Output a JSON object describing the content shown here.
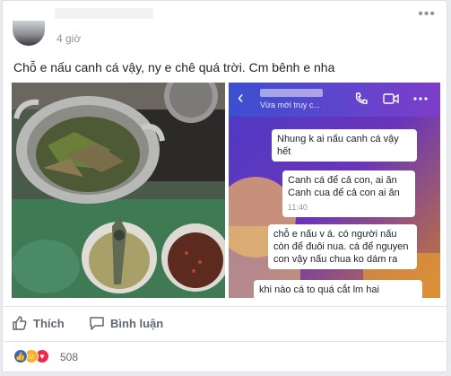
{
  "post": {
    "time": "4 giờ",
    "text": "Chỗ e nấu canh cá vậy, ny e chê quá trời. Cm bênh e nha",
    "more_label": "•••"
  },
  "chat": {
    "status": "Vừa mới truy c...",
    "messages": [
      {
        "lines": [
          "Nhung k ai nấu canh cá vậy",
          "hết"
        ]
      },
      {
        "lines": [
          "Canh cá để cả con, ai ăn",
          "Canh cua để cả con ai ăn"
        ],
        "time": "11:40"
      },
      {
        "lines": [
          "chỗ e nấu v á. có người nấu",
          "còn để đuôi nua. cá để nguyen",
          "con vậy nấu chua ko dám ra"
        ]
      },
      {
        "lines": [
          "khi nào cá to quá cắt lm hai"
        ]
      }
    ]
  },
  "actions": {
    "like": "Thích",
    "comment": "Bình luận"
  },
  "reactions": {
    "count": "508",
    "like_color": "#4267b2",
    "haha_color": "#f7b125",
    "love_color": "#f0284a"
  }
}
